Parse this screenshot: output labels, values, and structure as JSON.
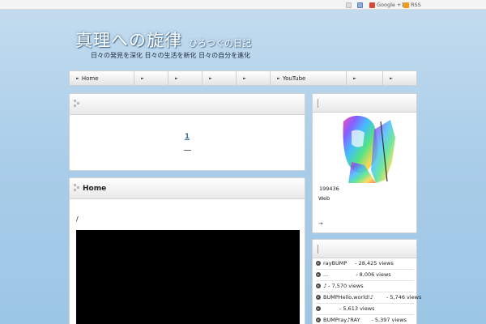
{
  "topbar": {
    "google": "Google +1",
    "rss": "RSS"
  },
  "header": {
    "title": "真理への旋律",
    "subtitle": "ひろつぐの日記",
    "tagline": "日々の発見を深化 日々の生活を新化 日々の自分を進化"
  },
  "nav": {
    "items": [
      {
        "label": "Home"
      },
      {
        "label": ""
      },
      {
        "label": ""
      },
      {
        "label": ""
      },
      {
        "label": ""
      },
      {
        "label": "YouTube"
      },
      {
        "label": ""
      },
      {
        "label": ""
      }
    ]
  },
  "main": {
    "pager": {
      "page": "1"
    },
    "post": {
      "title": "Home",
      "text": "/"
    }
  },
  "sidebar": {
    "profile": {
      "count": "199436",
      "web": "Web",
      "more": "→"
    },
    "popular": [
      {
        "title": "rayBUMP",
        "views": "- 28,425 views"
      },
      {
        "title": "...",
        "views": "- 8,006 views"
      },
      {
        "title": "♪",
        "views": "- 7,570 views"
      },
      {
        "title": "BUMPHello,world!♪",
        "views": "- 5,746 views"
      },
      {
        "title": "",
        "views": "- 5,613 views"
      },
      {
        "title": "BUMPray♪RAY",
        "views": "- 5,397 views"
      }
    ]
  },
  "colors": {
    "accent_link": "#3d6fa6",
    "background": "#a9cde9"
  }
}
